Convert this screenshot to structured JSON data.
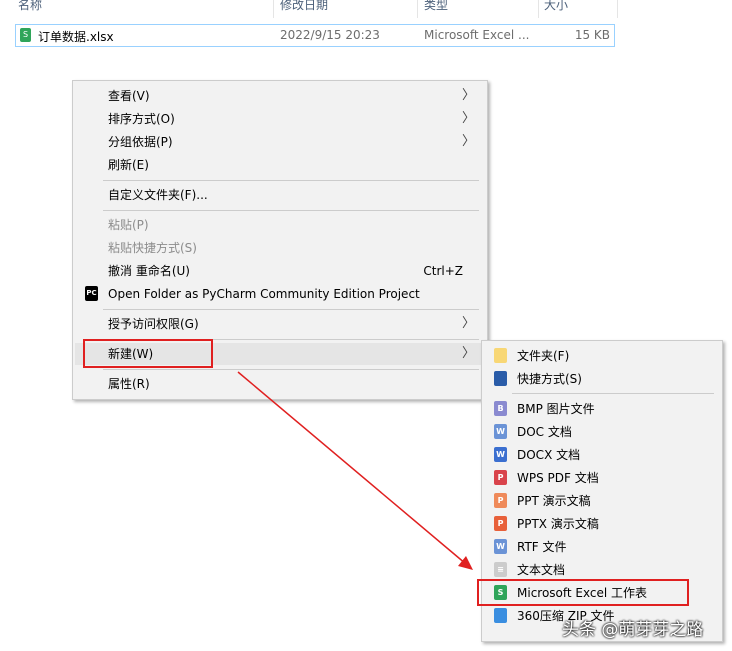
{
  "columns": [
    "名称",
    "修改日期",
    "类型",
    "大小"
  ],
  "file": {
    "name": "订单数据.xlsx",
    "modified": "2022/9/15 20:23",
    "type": "Microsoft Excel ...",
    "size": "15 KB"
  },
  "context_menu": [
    {
      "label": "查看(V)",
      "submenu": true
    },
    {
      "label": "排序方式(O)",
      "submenu": true
    },
    {
      "label": "分组依据(P)",
      "submenu": true
    },
    {
      "label": "刷新(E)"
    },
    {
      "label": "自定义文件夹(F)..."
    },
    {
      "label": "粘贴(P)",
      "disabled": true
    },
    {
      "label": "粘贴快捷方式(S)",
      "disabled": true
    },
    {
      "label": "撤消 重命名(U)",
      "shortcut": "Ctrl+Z"
    },
    {
      "label": "Open Folder as PyCharm Community Edition Project"
    },
    {
      "label": "授予访问权限(G)",
      "submenu": true
    },
    {
      "label": "新建(W)",
      "submenu": true
    },
    {
      "label": "属性(R)"
    }
  ],
  "new_submenu": [
    {
      "label": "文件夹(F)",
      "icon": "folder-icon",
      "color": "#f8d775"
    },
    {
      "label": "快捷方式(S)",
      "icon": "shortcut-icon",
      "color": "#2a5ca8"
    },
    {
      "label": "BMP 图片文件",
      "icon": "bmp-icon",
      "color": "#8a8ad0",
      "glyph": "B"
    },
    {
      "label": "DOC 文档",
      "icon": "doc-icon",
      "color": "#6b93d6",
      "glyph": "W"
    },
    {
      "label": "DOCX 文档",
      "icon": "docx-icon",
      "color": "#3b6fd0",
      "glyph": "W"
    },
    {
      "label": "WPS PDF 文档",
      "icon": "pdf-icon",
      "color": "#d9434b",
      "glyph": "P"
    },
    {
      "label": "PPT 演示文稿",
      "icon": "ppt-icon",
      "color": "#ef8a5a",
      "glyph": "P"
    },
    {
      "label": "PPTX 演示文稿",
      "icon": "pptx-icon",
      "color": "#e8603a",
      "glyph": "P"
    },
    {
      "label": "RTF 文件",
      "icon": "rtf-icon",
      "color": "#6b93d6",
      "glyph": "W"
    },
    {
      "label": "文本文档",
      "icon": "text-file-icon",
      "color": "#cccccc",
      "glyph": "≡"
    },
    {
      "label": "Microsoft Excel 工作表",
      "icon": "excel-icon",
      "color": "#2fa55a",
      "glyph": "S"
    },
    {
      "label": "360压缩 ZIP 文件",
      "icon": "zip-icon",
      "color": "#3a8ee0"
    }
  ],
  "watermark": "头条 @萌芽芽之路"
}
